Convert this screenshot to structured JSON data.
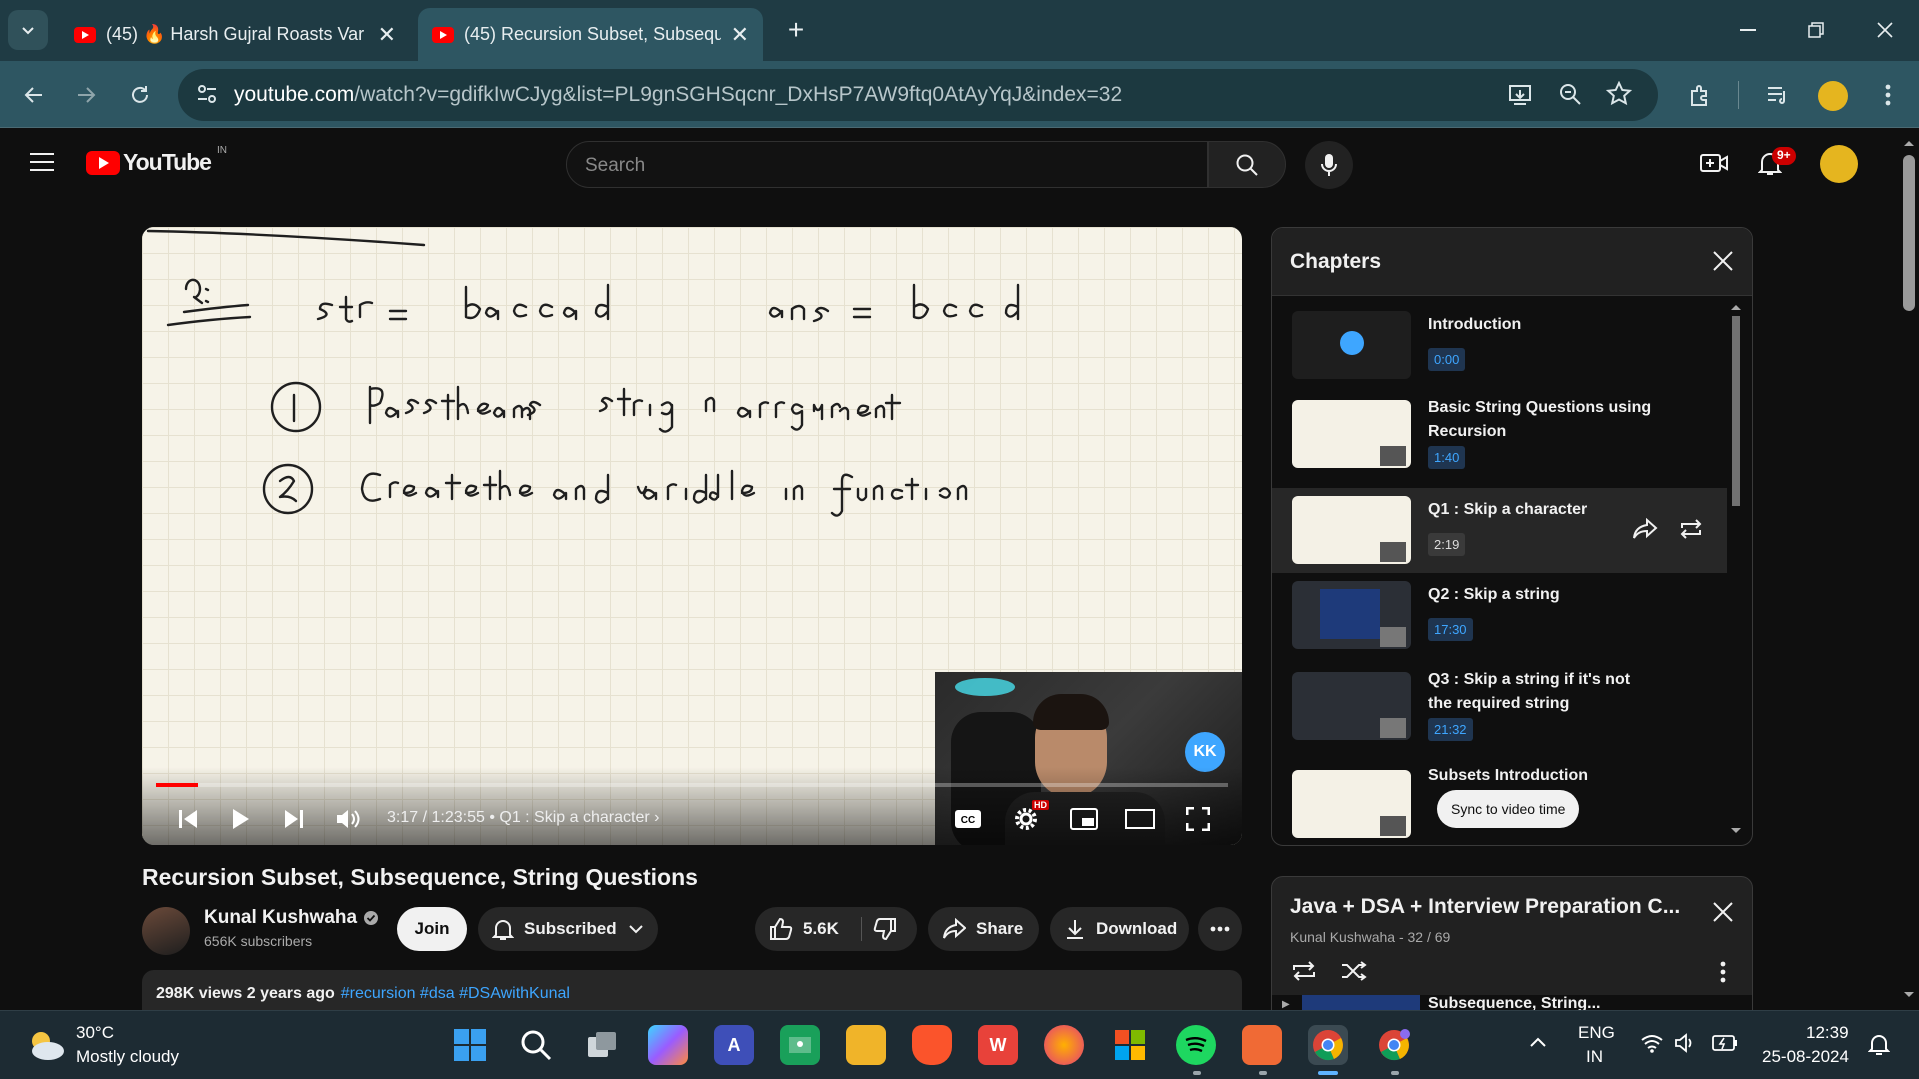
{
  "browser": {
    "tabs": [
      {
        "label": "(45) 🔥 Harsh Gujral Roasts Var",
        "active": false
      },
      {
        "label": "(45) Recursion Subset, Subsequ",
        "active": true
      }
    ],
    "new_tab_label": "+",
    "url_host": "youtube.com",
    "url_rest": "/watch?v=gdifkIwCJyg&list=PL9gnSGHSqcnr_DxHsP7AW9ftq0AtAyYqJ&index=32",
    "accent": "#2e5662"
  },
  "youtube": {
    "logo_text": "YouTube",
    "country": "IN",
    "search_placeholder": "Search",
    "notifications_badge": "9+"
  },
  "player": {
    "time": "3:17 / 1:23:55",
    "chapter_sep": "•",
    "chapter_label": "Q1 : Skip a character",
    "progress_fraction": 0.039,
    "hd_badge": "HD",
    "watermark": "KK"
  },
  "chapters": {
    "title": "Chapters",
    "items": [
      {
        "name": "Introduction",
        "time": "0:00"
      },
      {
        "name": "Basic String Questions using Recursion",
        "time": "1:40"
      },
      {
        "name": "Q1 : Skip a character",
        "time": "2:19"
      },
      {
        "name": "Q2 : Skip a string",
        "time": "17:30"
      },
      {
        "name": "Q3 : Skip a string if it's not the required string",
        "time": "21:32"
      },
      {
        "name": "Subsets Introduction",
        "time": ""
      }
    ],
    "sync_label": "Sync to video time"
  },
  "video": {
    "title": "Recursion Subset, Subsequence, String Questions",
    "channel": "Kunal Kushwaha",
    "subscribers": "656K subscribers",
    "join": "Join",
    "subscribed": "Subscribed",
    "likes": "5.6K",
    "share": "Share",
    "download": "Download",
    "views": "298K views  2 years ago",
    "tags": "#recursion #dsa #DSAwithKunal"
  },
  "playlist": {
    "title": "Java + DSA + Interview Preparation C...",
    "meta": "Kunal Kushwaha - 32 / 69",
    "next_item": "Subsequence, String..."
  },
  "taskbar": {
    "temp": "30°C",
    "weather": "Mostly cloudy",
    "lang": "ENG",
    "region": "IN",
    "time": "12:39",
    "date": "25-08-2024"
  }
}
